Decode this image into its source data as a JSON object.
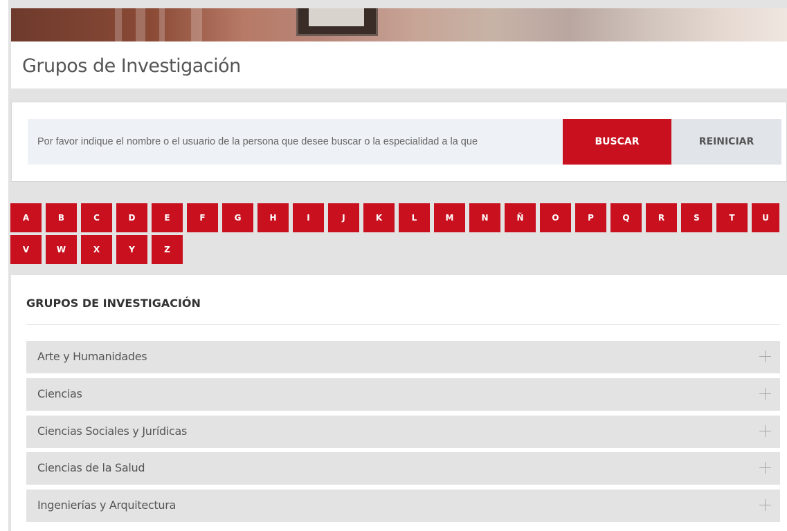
{
  "page": {
    "title": "Grupos de Investigación"
  },
  "search": {
    "placeholder": "Por favor indique el nombre o el usuario de la persona que desee buscar o la especialidad a la que",
    "buscar_label": "BUSCAR",
    "reiniciar_label": "REINICIAR"
  },
  "alphabet": [
    "A",
    "B",
    "C",
    "D",
    "E",
    "F",
    "G",
    "H",
    "I",
    "J",
    "K",
    "L",
    "M",
    "N",
    "Ñ",
    "O",
    "P",
    "Q",
    "R",
    "S",
    "T",
    "U",
    "V",
    "W",
    "X",
    "Y",
    "Z"
  ],
  "groups": {
    "heading": "GRUPOS DE INVESTIGACIÓN",
    "items": [
      {
        "label": "Arte y Humanidades",
        "icon": "plus-icon"
      },
      {
        "label": "Ciencias",
        "icon": "plus-icon"
      },
      {
        "label": "Ciencias Sociales y Jurídicas",
        "icon": "plus-icon"
      },
      {
        "label": "Ciencias de la Salud",
        "icon": "plus-icon"
      },
      {
        "label": "Ingenierías y Arquitectura",
        "icon": "plus-icon"
      }
    ]
  },
  "colors": {
    "accent": "#c8101e",
    "background": "#e3e3e3",
    "panel": "#ffffff"
  }
}
